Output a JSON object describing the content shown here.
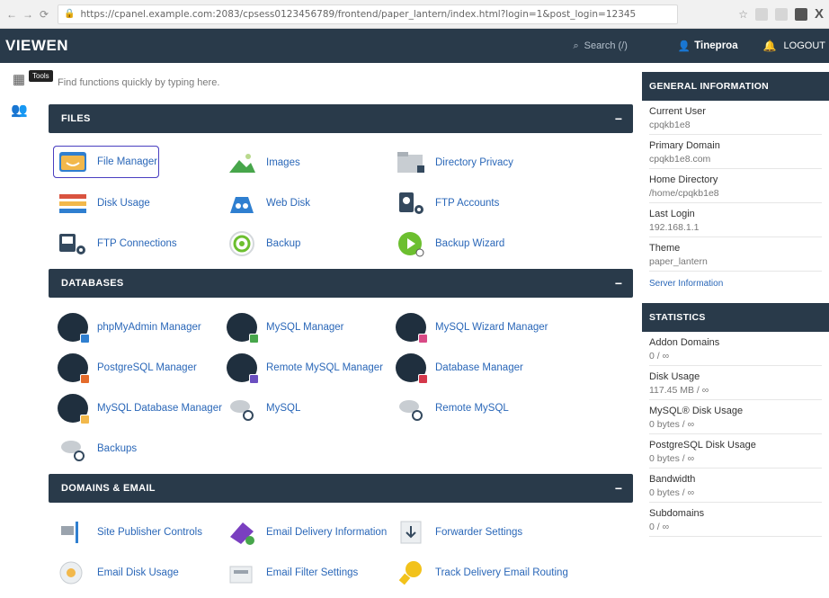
{
  "browser": {
    "url": "https://cpanel.example.com:2083/cpsess0123456789/frontend/paper_lantern/index.html?login=1&post_login=12345",
    "nav": [
      "←",
      "→",
      "⟳"
    ]
  },
  "header": {
    "logo": "VIEWEN",
    "search_placeholder": "Search (/)",
    "user": "Tineproa",
    "logout": "LOGOUT"
  },
  "rail": {
    "tooltip": "Tools"
  },
  "breadcrumb": "Find functions quickly by typing here.",
  "sections": [
    {
      "title": "FILES",
      "items": [
        {
          "label": "File Manager",
          "icon": "file-manager-icon",
          "color": "#f2b84b",
          "selected": true
        },
        {
          "label": "Images",
          "icon": "images-icon",
          "color": "#47a64b"
        },
        {
          "label": "Directory Privacy",
          "icon": "directory-privacy-icon",
          "color": "#9aa3ad"
        },
        {
          "label": "Disk Usage",
          "icon": "disk-usage-icon",
          "color": "#d9533f"
        },
        {
          "label": "Web Disk",
          "icon": "web-disk-icon",
          "color": "#2f7fd0"
        },
        {
          "label": "FTP Accounts",
          "icon": "ftp-accounts-icon",
          "color": "#34495e"
        },
        {
          "label": "FTP Connections",
          "icon": "ftp-connections-icon",
          "color": "#34495e"
        },
        {
          "label": "Backup",
          "icon": "backup-icon",
          "color": "#6cbf2f"
        },
        {
          "label": "Backup Wizard",
          "icon": "backup-wizard-icon",
          "color": "#6cbf2f"
        }
      ]
    },
    {
      "title": "DATABASES",
      "items": [
        {
          "label": "phpMyAdmin Manager",
          "icon": "phpmyadmin-icon",
          "color": "#2f7fd0"
        },
        {
          "label": "MySQL Manager",
          "icon": "mysql-manager-icon",
          "color": "#47a64b"
        },
        {
          "label": "MySQL Wizard Manager",
          "icon": "mysql-wizard-icon",
          "color": "#d94a86"
        },
        {
          "label": "PostgreSQL Manager",
          "icon": "postgresql-icon",
          "color": "#e46b2b"
        },
        {
          "label": "Remote MySQL Manager",
          "icon": "remote-mysql-icon",
          "color": "#6b4fc0"
        },
        {
          "label": "Database Manager",
          "icon": "database-manager-icon",
          "color": "#d4374a"
        },
        {
          "label": "MySQL Database Manager",
          "icon": "mysql-db-icon",
          "color": "#f2b84b"
        },
        {
          "label": "MySQL",
          "icon": "mysql-icon",
          "color": "#9aa3ad"
        },
        {
          "label": "Remote MySQL",
          "icon": "remote-mysql-plain-icon",
          "color": "#9aa3ad"
        },
        {
          "label": "Backups",
          "icon": "backups-icon",
          "color": "#9aa3ad"
        }
      ]
    },
    {
      "title": "DOMAINS & EMAIL",
      "items": [
        {
          "label": "Site Publisher Controls",
          "icon": "site-publisher-icon",
          "color": "#2f7fd0"
        },
        {
          "label": "Email Delivery Information",
          "icon": "email-delivery-icon",
          "color": "#7a3fc0"
        },
        {
          "label": "Forwarder Settings",
          "icon": "forwarder-icon",
          "color": "#9aa3ad"
        },
        {
          "label": "Email Disk Usage",
          "icon": "email-disk-icon",
          "color": "#f2b84b"
        },
        {
          "label": "Email Filter Settings",
          "icon": "email-filter-icon",
          "color": "#9aa3ad"
        },
        {
          "label": "Track Delivery Email Routing",
          "icon": "track-delivery-icon",
          "color": "#f2c21b"
        }
      ]
    }
  ],
  "sidebar": {
    "general": {
      "title": "GENERAL INFORMATION",
      "rows": [
        {
          "k": "Current User",
          "v": "cpqkb1e8"
        },
        {
          "k": "Primary Domain",
          "v": "cpqkb1e8.com"
        },
        {
          "k": "Home Directory",
          "v": "/home/cpqkb1e8"
        },
        {
          "k": "Last Login",
          "v": "192.168.1.1"
        },
        {
          "k": "Theme",
          "v": "paper_lantern"
        }
      ],
      "link": "Server Information"
    },
    "stats": {
      "title": "STATISTICS",
      "rows": [
        {
          "k": "Addon Domains",
          "v": "0 / ∞"
        },
        {
          "k": "Disk Usage",
          "v": "117.45 MB / ∞"
        },
        {
          "k": "MySQL® Disk Usage",
          "v": "0 bytes / ∞"
        },
        {
          "k": "PostgreSQL Disk Usage",
          "v": "0 bytes / ∞"
        },
        {
          "k": "Bandwidth",
          "v": "0 bytes / ∞"
        },
        {
          "k": "Subdomains",
          "v": "0 / ∞"
        }
      ]
    }
  }
}
